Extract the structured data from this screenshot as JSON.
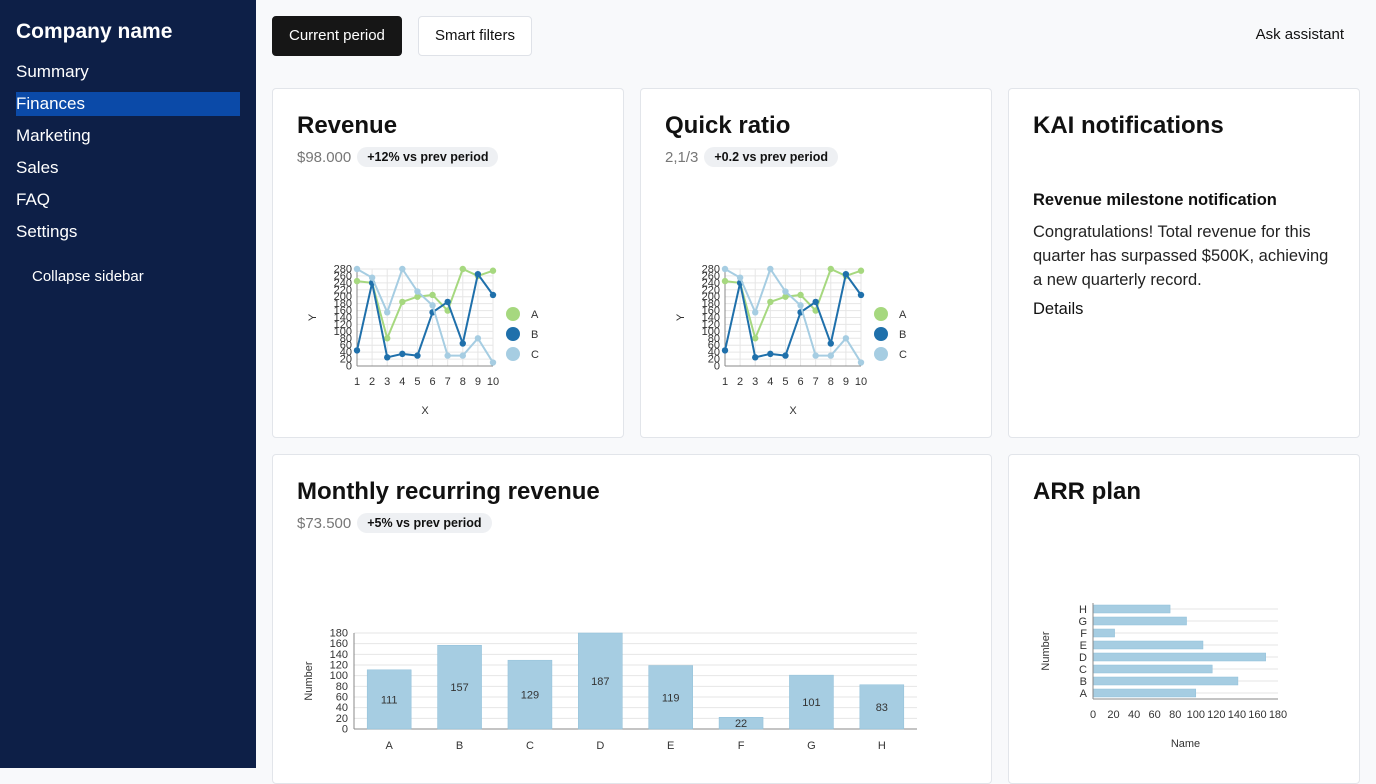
{
  "sidebar": {
    "company": "Company name",
    "items": [
      {
        "label": "Summary",
        "active": false
      },
      {
        "label": "Finances",
        "active": true
      },
      {
        "label": "Marketing",
        "active": false
      },
      {
        "label": "Sales",
        "active": false
      },
      {
        "label": "FAQ",
        "active": false
      },
      {
        "label": "Settings",
        "active": false
      }
    ],
    "collapse_label": "Collapse sidebar"
  },
  "toolbar": {
    "current_period": "Current period",
    "smart_filters": "Smart filters",
    "ask_assistant": "Ask assistant"
  },
  "revenue": {
    "title": "Revenue",
    "value": "$98.000",
    "badge": "+12% vs prev period"
  },
  "quick_ratio": {
    "title": "Quick ratio",
    "value": "2,1/3",
    "badge": "+0.2 vs prev period"
  },
  "notifications": {
    "title": "KAI notifications",
    "item_title": "Revenue milestone notification",
    "item_body": "Congratulations! Total revenue for this quarter has surpassed $500K, achieving a new quarterly record.",
    "details": "Details"
  },
  "mrr": {
    "title": "Monthly recurring revenue",
    "value": "$73.500",
    "badge": "+5% vs prev period"
  },
  "arr": {
    "title": "ARR plan"
  },
  "colors": {
    "A": "#a6d87f",
    "B": "#1f70ab",
    "C": "#a6cde2",
    "bar": "#a6cde2"
  },
  "chart_data": [
    {
      "type": "line",
      "id": "revenue",
      "x": [
        1,
        2,
        3,
        4,
        5,
        6,
        7,
        8,
        9,
        10
      ],
      "xlabel": "X",
      "ylabel": "Y",
      "ylim": [
        0,
        280
      ],
      "yticks": [
        0,
        20,
        40,
        60,
        80,
        100,
        120,
        140,
        160,
        180,
        200,
        220,
        240,
        260,
        280
      ],
      "series": [
        {
          "name": "A",
          "values": [
            245,
            240,
            80,
            185,
            200,
            205,
            160,
            290,
            260,
            275
          ]
        },
        {
          "name": "B",
          "values": [
            45,
            240,
            25,
            35,
            30,
            155,
            185,
            65,
            265,
            205
          ]
        },
        {
          "name": "C",
          "values": [
            285,
            255,
            155,
            295,
            215,
            175,
            30,
            30,
            80,
            10
          ]
        }
      ],
      "legend": "right",
      "grid": true
    },
    {
      "type": "line",
      "id": "quick_ratio",
      "x": [
        1,
        2,
        3,
        4,
        5,
        6,
        7,
        8,
        9,
        10
      ],
      "xlabel": "X",
      "ylabel": "Y",
      "ylim": [
        0,
        280
      ],
      "yticks": [
        0,
        20,
        40,
        60,
        80,
        100,
        120,
        140,
        160,
        180,
        200,
        220,
        240,
        260,
        280
      ],
      "series": [
        {
          "name": "A",
          "values": [
            245,
            240,
            80,
            185,
            200,
            205,
            160,
            290,
            260,
            275
          ]
        },
        {
          "name": "B",
          "values": [
            45,
            240,
            25,
            35,
            30,
            155,
            185,
            65,
            265,
            205
          ]
        },
        {
          "name": "C",
          "values": [
            285,
            255,
            155,
            295,
            215,
            175,
            30,
            30,
            80,
            10
          ]
        }
      ],
      "legend": "right",
      "grid": true
    },
    {
      "type": "bar",
      "id": "mrr",
      "categories": [
        "A",
        "B",
        "C",
        "D",
        "E",
        "F",
        "G",
        "H"
      ],
      "values": [
        111,
        157,
        129,
        187,
        119,
        22,
        101,
        83
      ],
      "xlabel": "",
      "ylabel": "Number",
      "ylim": [
        0,
        180
      ],
      "yticks": [
        0,
        20,
        40,
        60,
        80,
        100,
        120,
        140,
        160,
        180
      ],
      "grid": true
    },
    {
      "type": "bar",
      "orientation": "horizontal",
      "id": "arr",
      "categories": [
        "A",
        "B",
        "C",
        "D",
        "E",
        "F",
        "G",
        "H"
      ],
      "values": [
        100,
        141,
        116,
        168,
        107,
        21,
        91,
        75
      ],
      "xlabel": "Name",
      "ylabel": "Number",
      "xlim": [
        0,
        180
      ],
      "xticks": [
        0,
        20,
        40,
        60,
        80,
        100,
        120,
        140,
        160,
        180
      ],
      "grid": true
    }
  ]
}
